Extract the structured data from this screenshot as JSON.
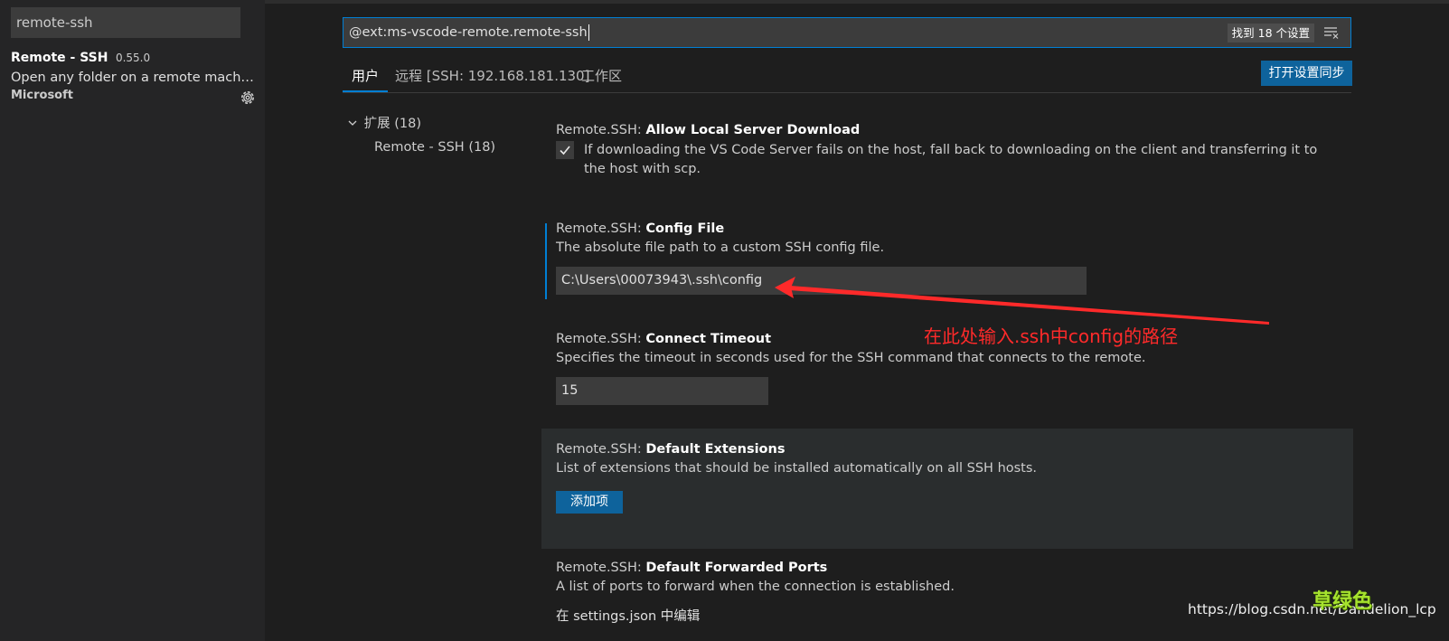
{
  "extensions_sidebar": {
    "search_value": "remote-ssh",
    "extension": {
      "title": "Remote - SSH",
      "version": "0.55.0",
      "description": "Open any folder on a remote machine...",
      "publisher": "Microsoft",
      "manage_icon": "gear-icon"
    }
  },
  "settings": {
    "search_value": "@ext:ms-vscode-remote.remote-ssh",
    "results_badge": "找到 18 个设置",
    "filter_icon": "clear-filter-icon",
    "tabs": [
      {
        "label": "用户"
      },
      {
        "label": "远程 [SSH: 192.168.181.130]"
      },
      {
        "label": "工作区"
      }
    ],
    "sync_button": "打开设置同步",
    "toc": {
      "group": "扩展",
      "group_count": "(18)",
      "item": "Remote - SSH (18)"
    },
    "items": [
      {
        "category": "Remote.SSH: ",
        "name": "Allow Local Server Download",
        "description": "If downloading the VS Code Server fails on the host, fall back to downloading on the client and transferring it to the host with scp.",
        "checked": true
      },
      {
        "category": "Remote.SSH: ",
        "name": "Config File",
        "description": "The absolute file path to a custom SSH config file.",
        "value": "C:\\Users\\00073943\\.ssh\\config"
      },
      {
        "category": "Remote.SSH: ",
        "name": "Connect Timeout",
        "description": "Specifies the timeout in seconds used for the SSH command that connects to the remote.",
        "value": "15"
      },
      {
        "category": "Remote.SSH: ",
        "name": "Default Extensions",
        "description": "List of extensions that should be installed automatically on all SSH hosts.",
        "button": "添加项"
      },
      {
        "category": "Remote.SSH: ",
        "name": "Default Forwarded Ports",
        "description": "A list of ports to forward when the connection is established.",
        "link": "在 settings.json 中编辑"
      }
    ]
  },
  "annotation": {
    "text": "在此处输入.ssh中config的路径",
    "color": "#ff2a2a"
  },
  "watermark": {
    "url": "https://blog.csdn.net/Dandelion_lcp",
    "logo": "草绿色"
  },
  "colors": {
    "accent": "#007fd4",
    "button": "#0e639c"
  }
}
